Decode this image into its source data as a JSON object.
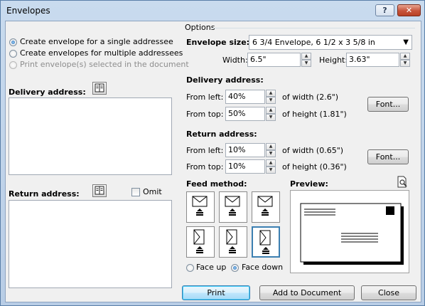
{
  "window": {
    "title": "Envelopes",
    "help_label": "?",
    "close_label": "✕"
  },
  "addressee_mode": {
    "single": "Create envelope for a single addressee",
    "multiple": "Create envelopes for multiple addressees",
    "selected": "Print envelope(s) selected in the document",
    "selected_value": "single"
  },
  "delivery": {
    "label": "Delivery address:",
    "value": ""
  },
  "return": {
    "label": "Return address:",
    "omit_label": "Omit",
    "omit_checked": false,
    "value": ""
  },
  "options": {
    "group_label": "Options",
    "envelope_size_label": "Envelope size:",
    "envelope_size_value": "6 3/4 Envelope, 6 1/2 x 3 5/8 in",
    "width_label": "Width:",
    "width_value": "6.5\"",
    "height_label": "Height:",
    "height_value": "3.63\""
  },
  "delivery_position": {
    "heading": "Delivery address:",
    "from_left_label": "From left:",
    "from_left_value": "40%",
    "from_left_note": "of width (2.6\")",
    "from_top_label": "From top:",
    "from_top_value": "50%",
    "from_top_note": "of height (1.81\")",
    "font_label": "Font..."
  },
  "return_position": {
    "heading": "Return address:",
    "from_left_label": "From left:",
    "from_left_value": "10%",
    "from_left_note": "of width (0.65\")",
    "from_top_label": "From top:",
    "from_top_value": "10%",
    "from_top_note": "of height (0.36\")",
    "font_label": "Font..."
  },
  "feed": {
    "label": "Feed method:",
    "face_up": "Face up",
    "face_down": "Face down",
    "face_selected": "face_down",
    "selected_index": 5
  },
  "preview": {
    "label": "Preview:"
  },
  "buttons": {
    "print": "Print",
    "add_to_document": "Add to Document",
    "close": "Close"
  },
  "icons": {
    "address_book": "address-book-icon",
    "preview_page": "print-preview-icon"
  }
}
